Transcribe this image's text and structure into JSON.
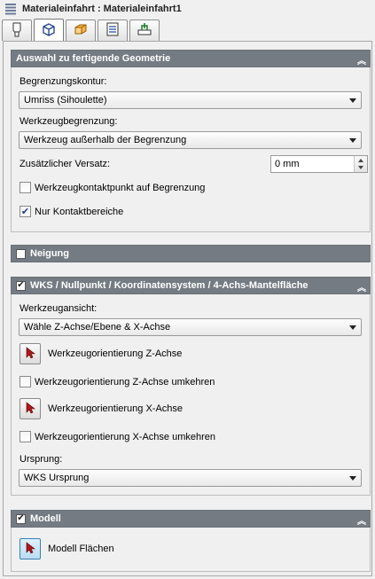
{
  "window": {
    "title": "Materialeinfahrt : Materialeinfahrt1",
    "title_icon": "stack-icon"
  },
  "tabs": [
    {
      "icon": "tool-icon",
      "active": false
    },
    {
      "icon": "geometry-cube-icon",
      "active": true
    },
    {
      "icon": "heights-box-icon",
      "active": false
    },
    {
      "icon": "list-icon",
      "active": false
    },
    {
      "icon": "link-plane-icon",
      "active": false
    }
  ],
  "geometry": {
    "header": "Auswahl zu fertigende Geometrie",
    "boundary_label": "Begrenzungskontur:",
    "boundary_value": "Umriss (Sihoulette)",
    "tool_boundary_label": "Werkzeugbegrenzung:",
    "tool_boundary_value": "Werkzeug außerhalb der Begrenzung",
    "offset_label": "Zusätzlicher Versatz:",
    "offset_value": "0 mm",
    "contact_point_label": "Werkzeugkontaktpunkt auf Begrenzung",
    "contact_point_checked": false,
    "only_contact_label": "Nur Kontaktbereiche",
    "only_contact_checked": true
  },
  "neigung": {
    "header": "Neigung",
    "checked": false
  },
  "wks": {
    "header": "WKS / Nullpunkt / Koordinatensystem / 4-Achs-Mantelfläche",
    "checked": true,
    "view_label": "Werkzeugansicht:",
    "view_value": "Wähle Z-Achse/Ebene & X-Achse",
    "z_axis_label": "Werkzeugorientierung Z-Achse",
    "z_flip_label": "Werkzeugorientierung Z-Achse umkehren",
    "z_flip_checked": false,
    "x_axis_label": "Werkzeugorientierung X-Achse",
    "x_flip_label": "Werkzeugorientierung X-Achse umkehren",
    "x_flip_checked": false,
    "origin_label": "Ursprung:",
    "origin_value": "WKS Ursprung"
  },
  "modell": {
    "header": "Modell",
    "checked": true,
    "faces_label": "Modell Flächen"
  },
  "colors": {
    "section_header": "#747b82",
    "panel_bg": "#f0f0f0",
    "picker_arrow": "#b11818"
  }
}
